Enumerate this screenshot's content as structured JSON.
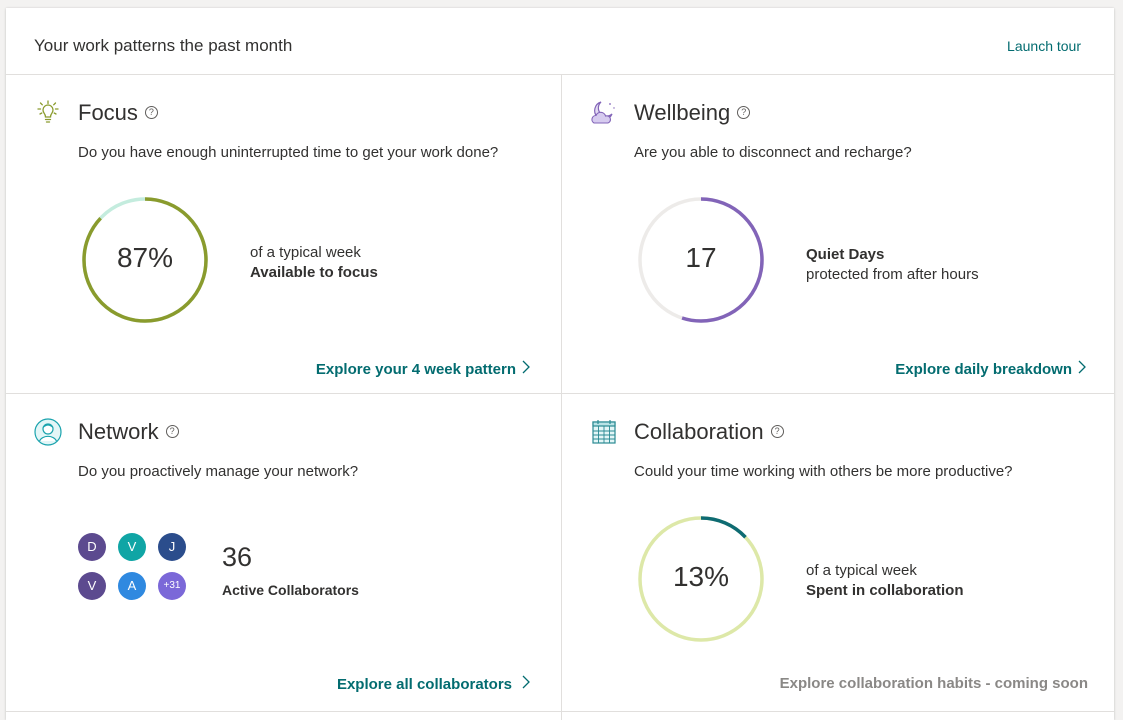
{
  "header": {
    "title": "Your work patterns the past month",
    "launch_tour": "Launch tour"
  },
  "focus": {
    "icon": "lightbulb-icon",
    "title": "Focus",
    "question": "Do you have enough uninterrupted time to get your work done?",
    "value_label": "87%",
    "percent": 87,
    "desc_line1": "of a typical week",
    "desc_line2": "Available to focus",
    "link": "Explore your 4 week pattern",
    "color": "#8a9b2d",
    "track_color": "#c4ecde"
  },
  "wellbeing": {
    "icon": "moon-cloud-icon",
    "title": "Wellbeing",
    "question": "Are you able to disconnect and recharge?",
    "value_label": "17",
    "fraction": 0.55,
    "desc_line1": "Quiet Days",
    "desc_line2": "protected from after hours",
    "link": "Explore daily breakdown",
    "color": "#8264b8",
    "track_color": "#edebe9"
  },
  "network": {
    "icon": "person-icon",
    "title": "Network",
    "question": "Do you proactively manage your network?",
    "count": "36",
    "count_label": "Active Collaborators",
    "avatars": [
      {
        "initial": "D",
        "color": "#5c4a8f"
      },
      {
        "initial": "V",
        "color": "#10a5a5"
      },
      {
        "initial": "J",
        "color": "#2b4d8c"
      },
      {
        "initial": "V",
        "color": "#5c4a8f"
      },
      {
        "initial": "A",
        "color": "#2f89e0"
      },
      {
        "initial": "+31",
        "color": "#7b68d8"
      }
    ],
    "link": "Explore all collaborators"
  },
  "collaboration": {
    "icon": "calendar-icon",
    "title": "Collaboration",
    "question": "Could your time working with others be more productive?",
    "value_label": "13%",
    "percent": 13,
    "desc_line1": "of a typical week",
    "desc_line2": "Spent in collaboration",
    "link": "Explore collaboration habits - coming soon",
    "color": "#0e6b73",
    "track_color": "#dde8a8"
  }
}
